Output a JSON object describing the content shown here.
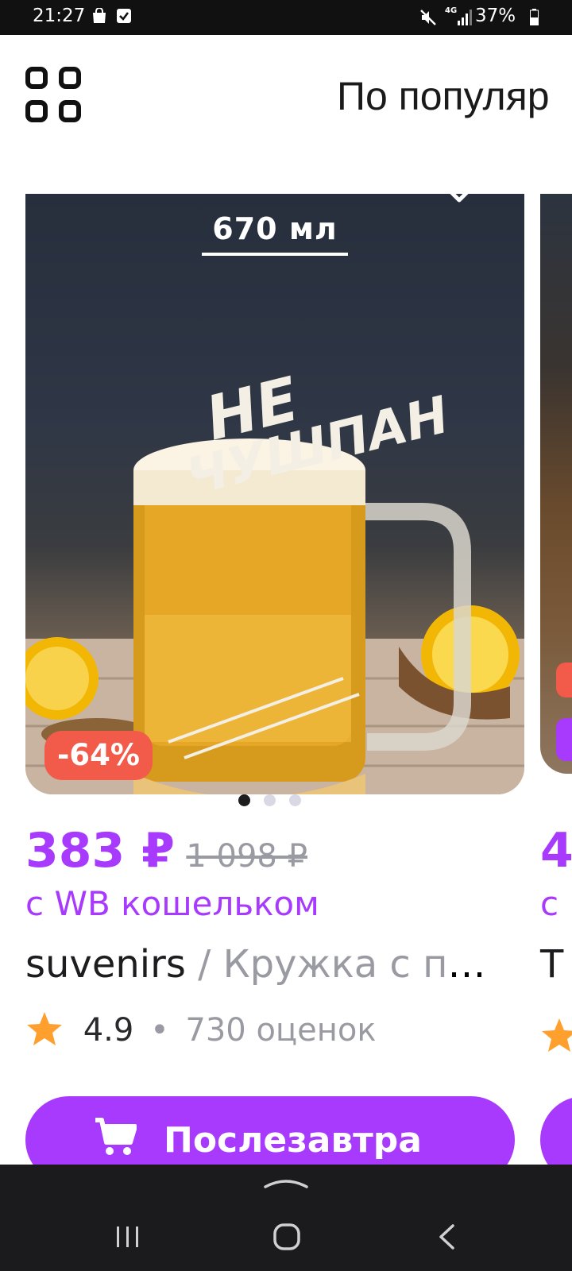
{
  "status_bar": {
    "time": "21:27",
    "network": "4G",
    "battery": "37%"
  },
  "header": {
    "sort_label": "По популяр",
    "grid_icon": "grid-view-icon"
  },
  "product": {
    "photo_caption": "670 мл",
    "mug_print_line1": "НЕ",
    "mug_print_line2": "ЧУШПАН",
    "discount": "-64%",
    "carousel_images": 3,
    "carousel_active": 1,
    "price": "383 ₽",
    "old_price": "1 098 ₽",
    "wallet_note": "с WB кошельком",
    "brand": "suvenirs",
    "separator": " / ",
    "name": "Кружка с пр...",
    "rating": "4.9",
    "bullet": "•",
    "reviews": "730 оценок",
    "cart_label": "Послезавтра"
  },
  "next_product": {
    "price": "4",
    "wallet_note": "с",
    "title": "T"
  },
  "colors": {
    "accent": "#a73afd",
    "discount": "#f25a4a",
    "star": "#ff9f2e",
    "muted": "#9a9aa2",
    "nav_bg": "#1b1b1d"
  }
}
